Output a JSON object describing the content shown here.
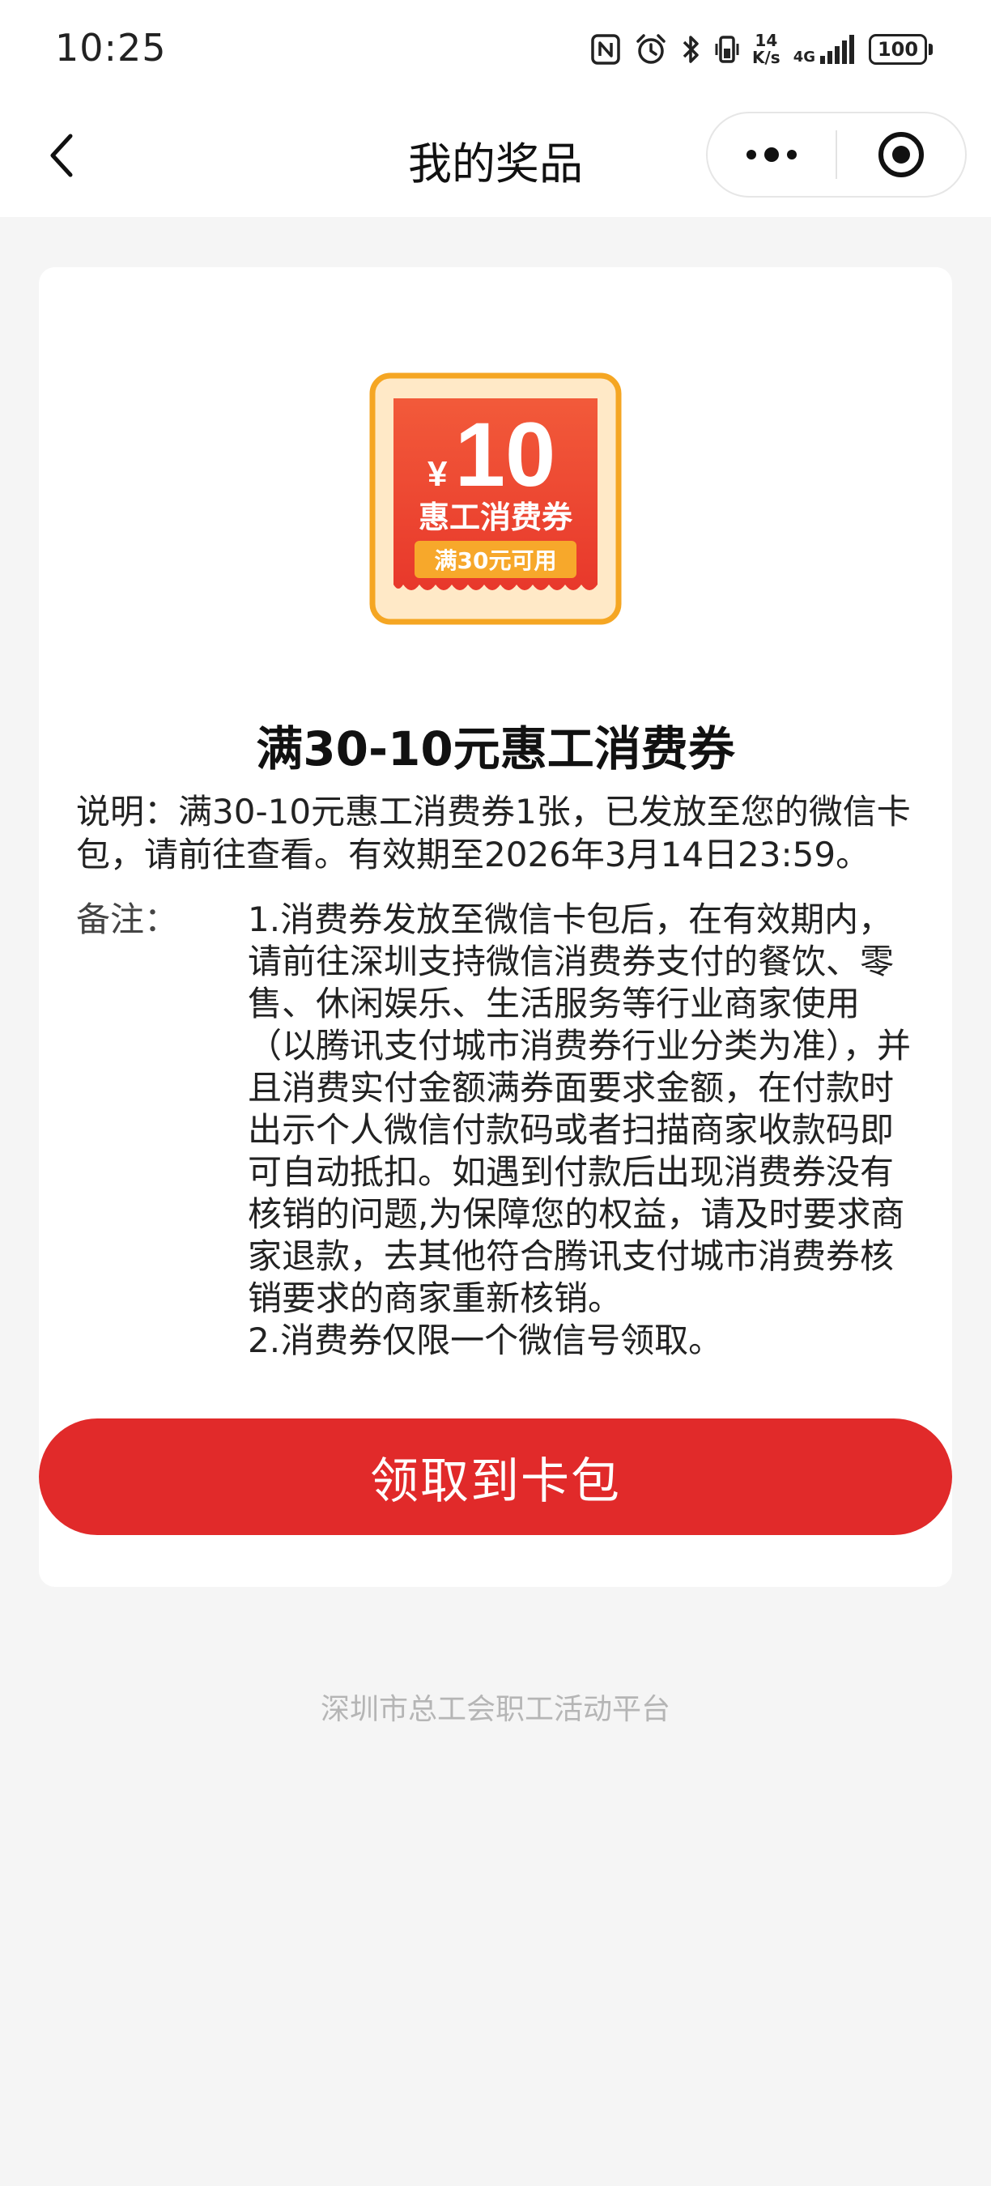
{
  "status_bar": {
    "time": "10:25",
    "speed_value": "14",
    "speed_unit": "K/s",
    "network": "4G",
    "battery": "100"
  },
  "nav": {
    "title": "我的奖品"
  },
  "coupon": {
    "icon_currency": "¥",
    "icon_amount": "10",
    "icon_name": "惠工消费券",
    "icon_condition": "满30元可用",
    "title": "满30-10元惠工消费券",
    "description": "说明：满30-10元惠工消费券1张，已发放至您的微信卡包，请前往查看。有效期至2026年3月14日23:59。",
    "notes_label": "备注：",
    "note_1": "1.消费券发放至微信卡包后，在有效期内，请前往深圳支持微信消费券支付的餐饮、零售、休闲娱乐、生活服务等行业商家使用（以腾讯支付城市消费券行业分类为准），并且消费实付金额满券面要求金额，在付款时出示个人微信付款码或者扫描商家收款码即可自动抵扣。如遇到付款后出现消费券没有核销的问题,为保障您的权益，请及时要求商家退款，去其他符合腾讯支付城市消费券核销要求的商家重新核销。",
    "note_2": "2.消费券仅限一个微信号领取。",
    "claim_label": "领取到卡包"
  },
  "footer": {
    "text": "深圳市总工会职工活动平台"
  },
  "colors": {
    "accent_red": "#e12a2a",
    "coupon_orange": "#f5a623",
    "page_bg": "#f5f5f5"
  },
  "icons": {
    "status": [
      "nfc-icon",
      "alarm-icon",
      "bluetooth-icon",
      "vibrate-icon",
      "signal-icon",
      "battery-icon"
    ],
    "nav": [
      "back-arrow-icon",
      "more-dots-icon",
      "close-target-icon"
    ]
  }
}
